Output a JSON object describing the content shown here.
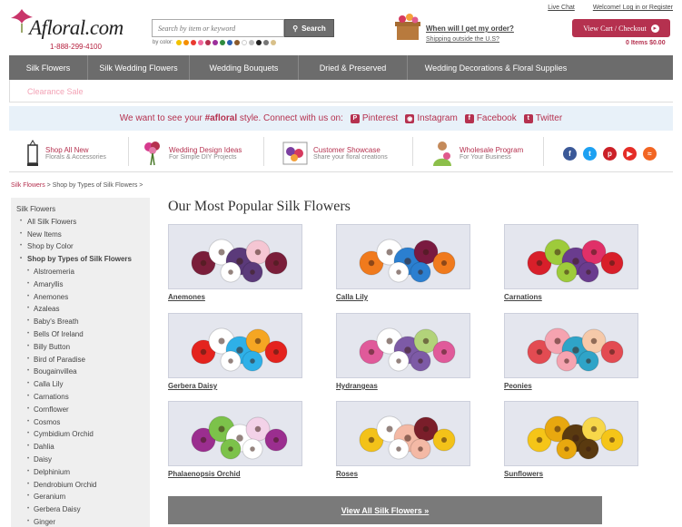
{
  "header": {
    "logo_text": "Afloral.com",
    "phone": "1-888-299-4100",
    "search_placeholder": "Search by item or keyword",
    "search_label": "Search",
    "by_color_label": "by color:",
    "color_swatches": [
      "#f2c200",
      "#f58f00",
      "#e93a2f",
      "#f06a9e",
      "#b5314f",
      "#9c2f9c",
      "#2e8b3e",
      "#2d5fb0",
      "#8b5a2b",
      "#ffffff",
      "#bdbdbd",
      "#222222",
      "#777777",
      "#d8c08a"
    ],
    "order_question": "When will I get my order?",
    "shipping_link": "Shipping outside the U.S?",
    "live_chat": "Live Chat",
    "welcome_text": "Welcome! Log in or Register",
    "cart_label": "View Cart / Checkout",
    "cart_summary": "0 Items $0.00"
  },
  "nav": {
    "items": [
      "Silk Flowers",
      "Silk Wedding Flowers",
      "Wedding Bouquets",
      "Dried & Preserved",
      "Wedding Decorations & Floral Supplies"
    ],
    "clearance": "Clearance Sale"
  },
  "social": {
    "text_before": "We want to see your",
    "hashtag": "#afloral",
    "text_after": "style. Connect with us on:",
    "links": [
      "Pinterest",
      "Instagram",
      "Facebook",
      "Twitter"
    ]
  },
  "promos": [
    {
      "title": "Shop All New",
      "sub": "Florals & Accessories"
    },
    {
      "title": "Wedding Design Ideas",
      "sub": "For Simple DIY Projects"
    },
    {
      "title": "Customer Showcase",
      "sub": "Share your floral creations"
    },
    {
      "title": "Wholesale Program",
      "sub": "For Your Business"
    }
  ],
  "social_icon_colors": [
    "#3b5998",
    "#1da1f2",
    "#cb2027",
    "#e52d27",
    "#f26522"
  ],
  "breadcrumb": {
    "root": "Silk Flowers",
    "rest": " > Shop by Types of Silk Flowers >"
  },
  "sidebar": {
    "top": "Silk Flowers",
    "level1": [
      "All Silk Flowers",
      "New Items",
      "Shop by Color"
    ],
    "active": "Shop by Types of Silk Flowers",
    "types": [
      "Alstroemeria",
      "Amaryllis",
      "Anemones",
      "Azaleas",
      "Baby's Breath",
      "Bells Of Ireland",
      "Billy Button",
      "Bird of Paradise",
      "Bougainvillea",
      "Calla Lily",
      "Carnations",
      "Cornflower",
      "Cosmos",
      "Cymbidium Orchid",
      "Dahlia",
      "Daisy",
      "Delphinium",
      "Dendrobium Orchid",
      "Geranium",
      "Gerbera Daisy",
      "Ginger"
    ]
  },
  "main": {
    "heading": "Our Most Popular Silk Flowers",
    "products": [
      {
        "name": "Anemones",
        "colors": [
          "#7a1e3a",
          "#ffffff",
          "#5b3a7a",
          "#f5c6d3"
        ]
      },
      {
        "name": "Calla Lily",
        "colors": [
          "#f07a1d",
          "#ffffff",
          "#2b7fd0",
          "#7a1a40"
        ]
      },
      {
        "name": "Carnations",
        "colors": [
          "#d81f2a",
          "#9ecb3b",
          "#6a3c8e",
          "#e03068"
        ]
      },
      {
        "name": "Gerbera Daisy",
        "colors": [
          "#e4231e",
          "#ffffff",
          "#2eb0e8",
          "#f5a623"
        ]
      },
      {
        "name": "Hydrangeas",
        "colors": [
          "#e05a9a",
          "#ffffff",
          "#7d5aa6",
          "#b2d37a"
        ]
      },
      {
        "name": "Peonies",
        "colors": [
          "#e34b52",
          "#f5a3b0",
          "#2fa4c8",
          "#f6c9a9"
        ]
      },
      {
        "name": "Phalaenopsis Orchid",
        "colors": [
          "#9b2e8f",
          "#7cc24a",
          "#ffffff",
          "#f3d2e8"
        ]
      },
      {
        "name": "Roses",
        "colors": [
          "#f3c219",
          "#ffffff",
          "#f4b9a5",
          "#7a1e2a"
        ]
      },
      {
        "name": "Sunflowers",
        "colors": [
          "#f5c518",
          "#e8a80f",
          "#5a3a10",
          "#f7d74a"
        ]
      }
    ],
    "view_all": "View All Silk Flowers »"
  }
}
